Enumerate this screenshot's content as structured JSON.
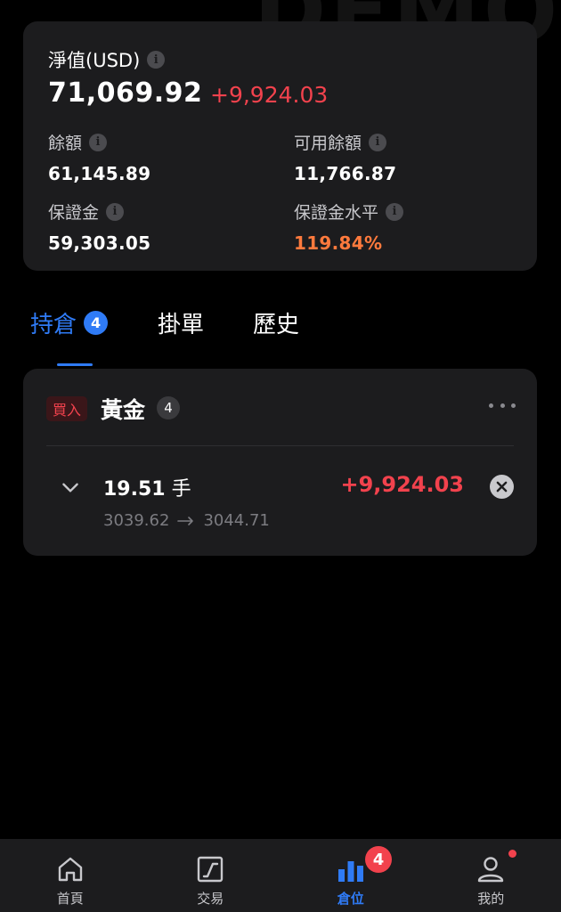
{
  "watermark": "DEMO",
  "summary": {
    "nav_label": "淨值(USD)",
    "equity": "71,069.92",
    "floating_pnl": "+9,924.03",
    "balance_label": "餘額",
    "balance": "61,145.89",
    "available_label": "可用餘額",
    "available": "11,766.87",
    "margin_label": "保證金",
    "margin": "59,303.05",
    "margin_level_label": "保證金水平",
    "margin_level": "119.84%"
  },
  "tabs": [
    {
      "label": "持倉",
      "badge": "4",
      "active": true
    },
    {
      "label": "掛單"
    },
    {
      "label": "歷史"
    }
  ],
  "position": {
    "side": "買入",
    "symbol": "黃金",
    "count": "4",
    "lots": "19.51",
    "lots_unit": "手",
    "pnl": "+9,924.03",
    "open_price": "3039.62",
    "current_price": "3044.71"
  },
  "bottom_nav": [
    {
      "label": "首頁",
      "icon": "home-icon"
    },
    {
      "label": "交易",
      "icon": "trade-chart-icon"
    },
    {
      "label": "倉位",
      "icon": "positions-bar-chart-icon",
      "badge": "4",
      "active": true
    },
    {
      "label": "我的",
      "icon": "profile-icon",
      "dot": true
    }
  ],
  "colors": {
    "accent": "#2f7bf6",
    "loss_profit_red": "#f2424d",
    "warning_orange": "#ff7a3d",
    "card_bg": "#1c1c1e"
  }
}
